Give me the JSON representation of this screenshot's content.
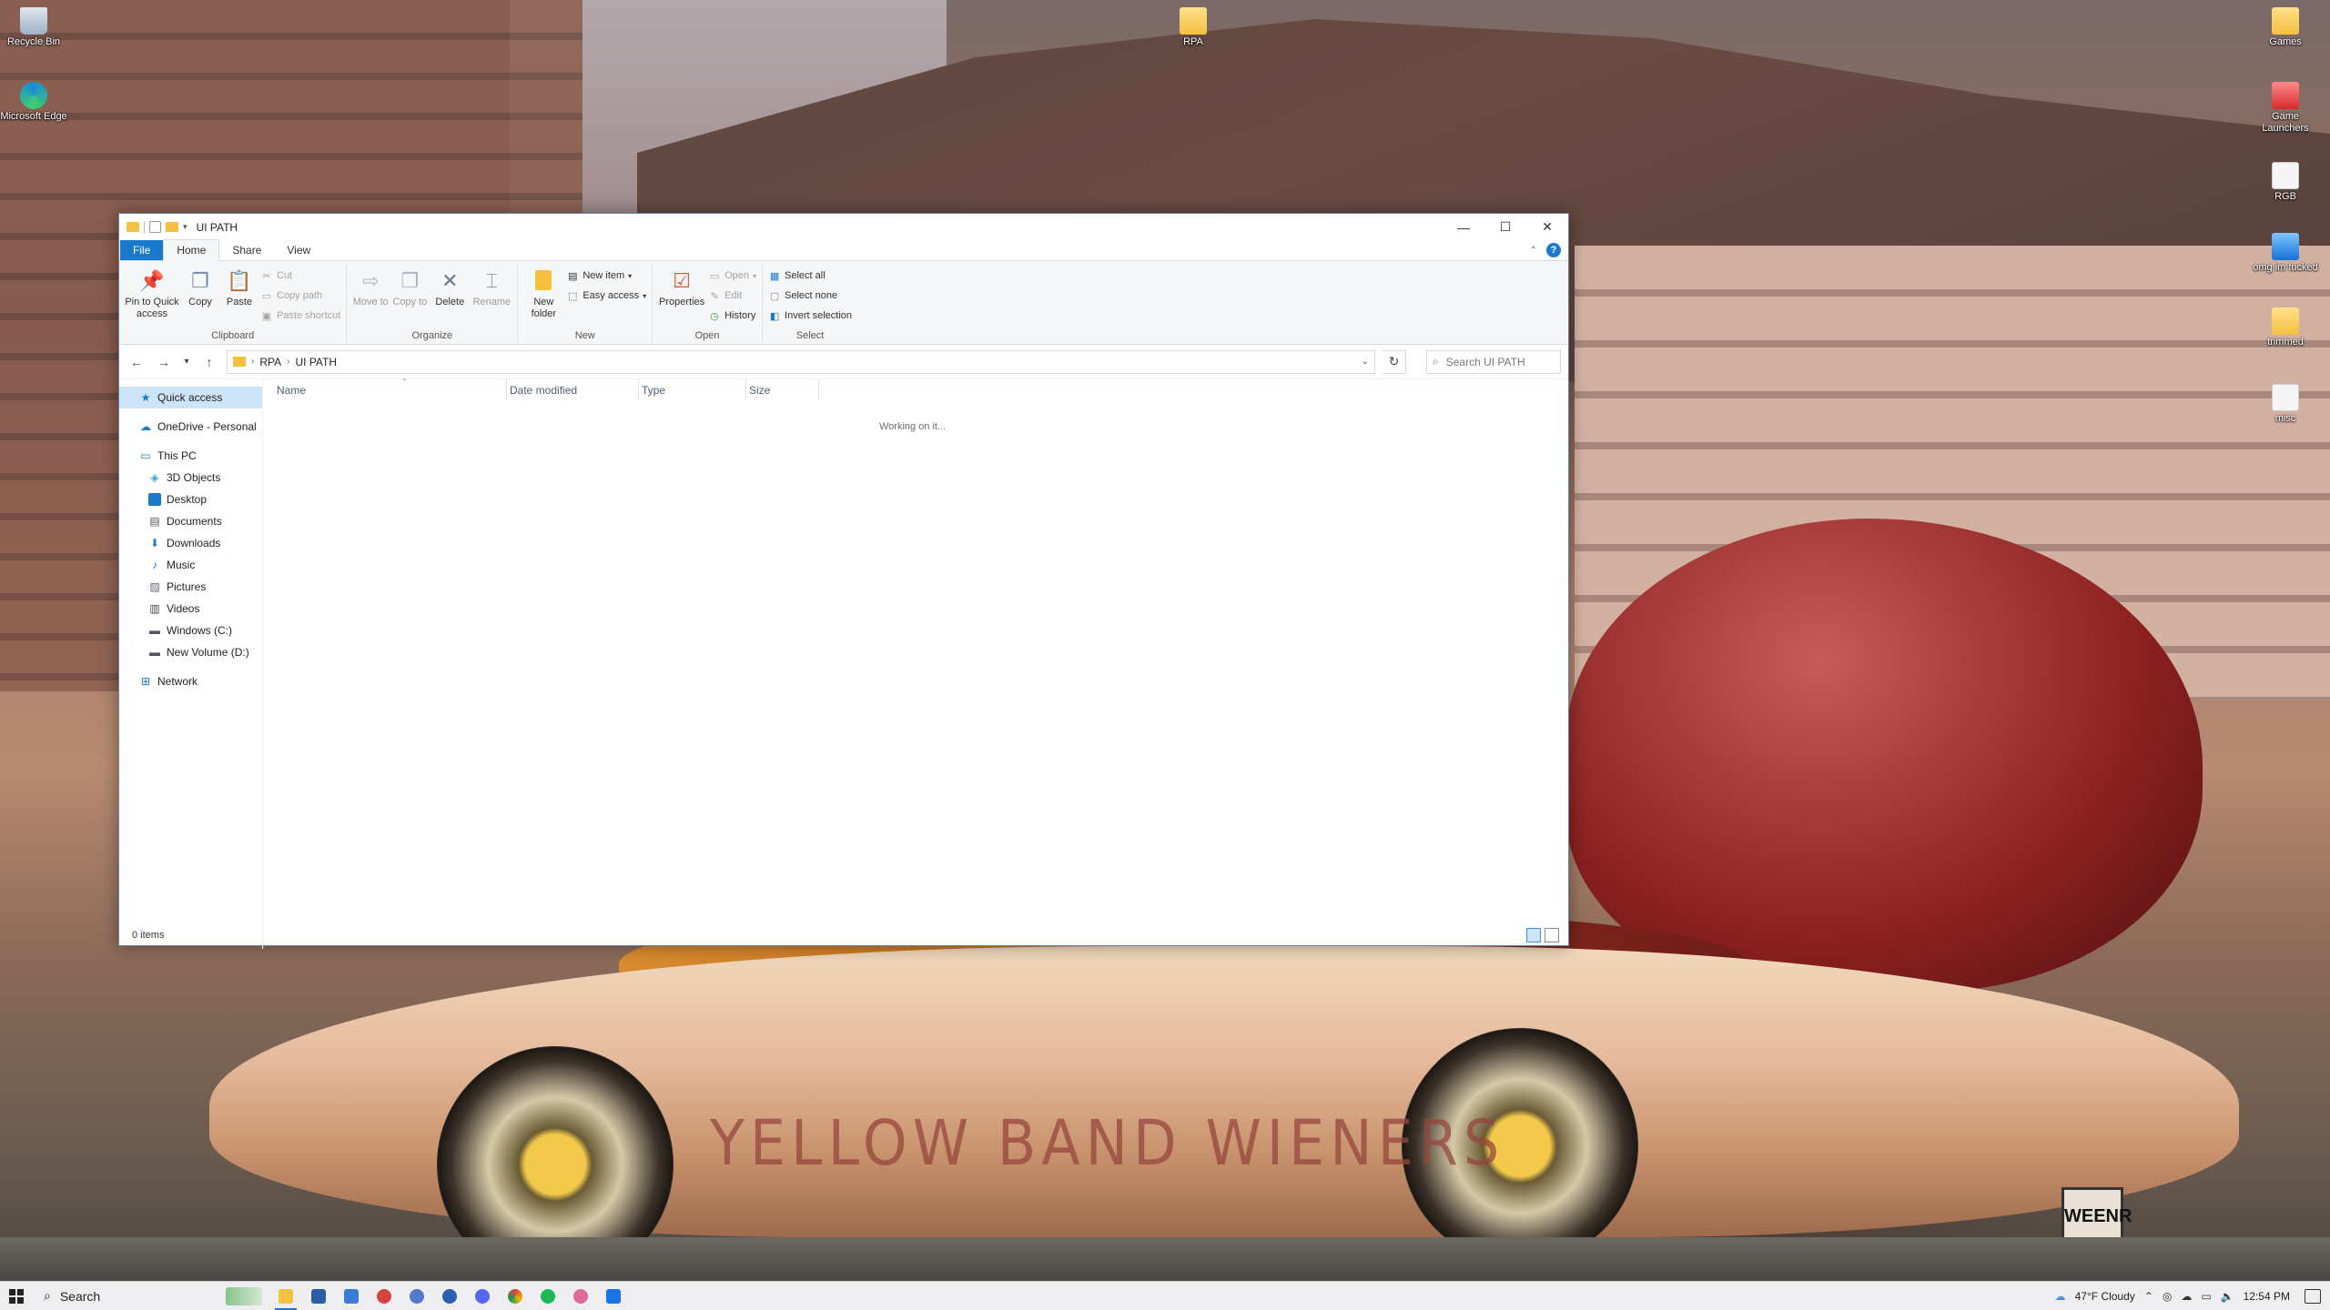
{
  "desktop": {
    "icons": [
      {
        "label": "Recycle Bin"
      },
      {
        "label": "Microsoft Edge"
      },
      {
        "label": "RPA"
      },
      {
        "label": "Games"
      },
      {
        "label": "Game Launchers"
      },
      {
        "label": "RGB"
      },
      {
        "label": "omg im fucked"
      },
      {
        "label": "trimmed"
      },
      {
        "label": "misc"
      }
    ],
    "wallpaper_text": "YELLOW BAND WIENERS",
    "plate_text": "WEENR"
  },
  "window": {
    "title": "UI PATH",
    "controls": {
      "minimize": "—",
      "maximize": "☐",
      "close": "✕"
    },
    "tabs": {
      "file": "File",
      "home": "Home",
      "share": "Share",
      "view": "View"
    },
    "help": "?",
    "ribbon": {
      "clipboard": {
        "label": "Clipboard",
        "pin": "Pin to Quick access",
        "copy": "Copy",
        "paste": "Paste",
        "cut": "Cut",
        "copy_path": "Copy path",
        "paste_shortcut": "Paste shortcut"
      },
      "organize": {
        "label": "Organize",
        "move_to": "Move to",
        "copy_to": "Copy to",
        "delete": "Delete",
        "rename": "Rename"
      },
      "new": {
        "label": "New",
        "new_folder": "New folder",
        "new_item": "New item",
        "easy_access": "Easy access"
      },
      "open": {
        "label": "Open",
        "properties": "Properties",
        "open": "Open",
        "edit": "Edit",
        "history": "History"
      },
      "select": {
        "label": "Select",
        "select_all": "Select all",
        "select_none": "Select none",
        "invert": "Invert selection"
      }
    },
    "address": {
      "crumbs": [
        "RPA",
        "UI PATH"
      ],
      "search_placeholder": "Search UI PATH"
    },
    "nav_pane": {
      "quick_access": "Quick access",
      "onedrive": "OneDrive - Personal",
      "this_pc": "This PC",
      "pc_items": [
        "3D Objects",
        "Desktop",
        "Documents",
        "Downloads",
        "Music",
        "Pictures",
        "Videos",
        "Windows (C:)",
        "New Volume (D:)"
      ],
      "network": "Network"
    },
    "columns": [
      "Name",
      "Date modified",
      "Type",
      "Size"
    ],
    "status_message": "Working on it...",
    "item_count": "0 items"
  },
  "taskbar": {
    "search_label": "Search",
    "weather": "47°F  Cloudy",
    "time": "12:54 PM"
  },
  "colors": {
    "accent": "#1979ca",
    "selection": "#cce4f7",
    "folder": "#f4c040"
  }
}
